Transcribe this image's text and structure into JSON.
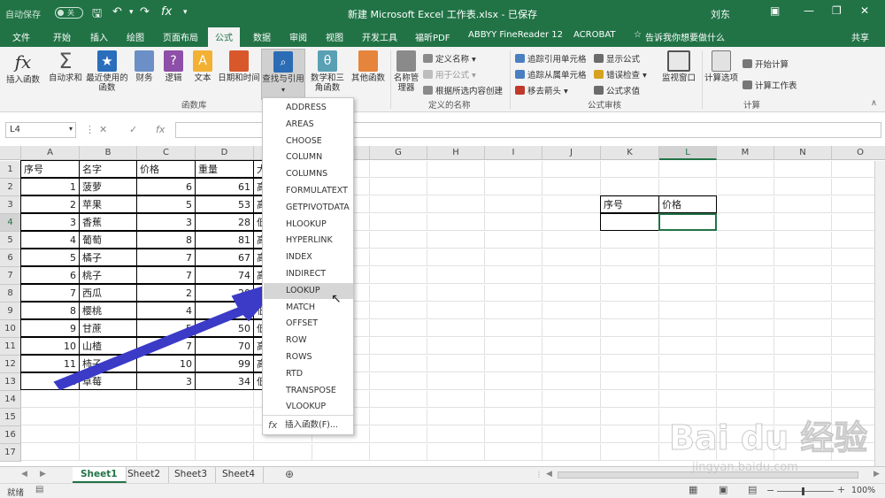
{
  "titlebar": {
    "autosave": "自动保存",
    "autosave_state": "关",
    "title": "新建 Microsoft Excel 工作表.xlsx  -  已保存",
    "user": "刘东"
  },
  "tabs": [
    "文件",
    "开始",
    "插入",
    "绘图",
    "页面布局",
    "公式",
    "数据",
    "审阅",
    "视图",
    "开发工具",
    "福昕PDF",
    "ABBYY FineReader 12",
    "ACROBAT"
  ],
  "active_tab": "公式",
  "tell_me": "告诉我你想要做什么",
  "share": "共享",
  "ribbon": {
    "insert_function": "插入函数",
    "autosum": "自动求和",
    "recent": "最近使用的函数",
    "financial": "财务",
    "logical": "逻辑",
    "text": "文本",
    "datetime": "日期和时间",
    "lookup": "查找与引用",
    "math": "数学和三角函数",
    "more": "其他函数",
    "group_library": "函数库",
    "name_manager": "名称管理器",
    "define_name": "定义名称",
    "use_in_formula": "用于公式",
    "create_from_sel": "根据所选内容创建",
    "group_names": "定义的名称",
    "trace_precedents": "追踪引用单元格",
    "trace_dependents": "追踪从属单元格",
    "remove_arrows": "移去箭头",
    "show_formulas": "显示公式",
    "error_checking": "错误检查",
    "evaluate_formula": "公式求值",
    "group_audit": "公式审核",
    "watch_window": "监视窗口",
    "calc_options": "计算选项",
    "calc_now": "开始计算",
    "calc_sheet": "计算工作表",
    "group_calc": "计算"
  },
  "formula_bar": {
    "name_box": "L4",
    "fx": "fx"
  },
  "columns": [
    "A",
    "B",
    "C",
    "D",
    "E",
    "F",
    "G",
    "H",
    "I",
    "J",
    "K",
    "L",
    "M",
    "N",
    "O",
    "P",
    "Q"
  ],
  "rows": [
    "1",
    "2",
    "3",
    "4",
    "5",
    "6",
    "7",
    "8",
    "9",
    "10",
    "11",
    "12",
    "13",
    "14",
    "15",
    "16",
    "17"
  ],
  "table": {
    "headers": [
      "序号",
      "名字",
      "价格",
      "重量",
      "大"
    ],
    "rows": [
      [
        "1",
        "菠萝",
        "6",
        "61",
        "高"
      ],
      [
        "2",
        "苹果",
        "5",
        "53",
        "高"
      ],
      [
        "3",
        "香蕉",
        "3",
        "28",
        "低"
      ],
      [
        "4",
        "葡萄",
        "8",
        "81",
        "高"
      ],
      [
        "5",
        "橘子",
        "7",
        "67",
        "高"
      ],
      [
        "6",
        "桃子",
        "7",
        "74",
        "高"
      ],
      [
        "7",
        "西瓜",
        "2",
        "20",
        "低"
      ],
      [
        "8",
        "樱桃",
        "4",
        "36",
        "低"
      ],
      [
        "9",
        "甘蔗",
        "5",
        "50",
        "低"
      ],
      [
        "10",
        "山楂",
        "7",
        "70",
        "高"
      ],
      [
        "11",
        "柿子",
        "10",
        "99",
        "高"
      ],
      [
        "12",
        "草莓",
        "3",
        "34",
        "低"
      ]
    ]
  },
  "lookup_table": {
    "h1": "序号",
    "h2": "价格"
  },
  "menu": {
    "items": [
      "ADDRESS",
      "AREAS",
      "CHOOSE",
      "COLUMN",
      "COLUMNS",
      "FORMULATEXT",
      "GETPIVOTDATA",
      "HLOOKUP",
      "HYPERLINK",
      "INDEX",
      "INDIRECT",
      "LOOKUP",
      "MATCH",
      "OFFSET",
      "ROW",
      "ROWS",
      "RTD",
      "TRANSPOSE",
      "VLOOKUP"
    ],
    "highlighted": "LOOKUP",
    "footer": "插入函数(F)..."
  },
  "sheets": [
    "Sheet1",
    "Sheet2",
    "Sheet3",
    "Sheet4"
  ],
  "active_sheet": "Sheet1",
  "status": {
    "ready": "就绪",
    "zoom": "100%"
  },
  "colors": {
    "excel_green": "#217346",
    "arrow": "#3b3bc8",
    "cursor": "#eee61e"
  },
  "watermark": {
    "brand": "Bai du 经验",
    "url": "jingyan.baidu.com"
  }
}
